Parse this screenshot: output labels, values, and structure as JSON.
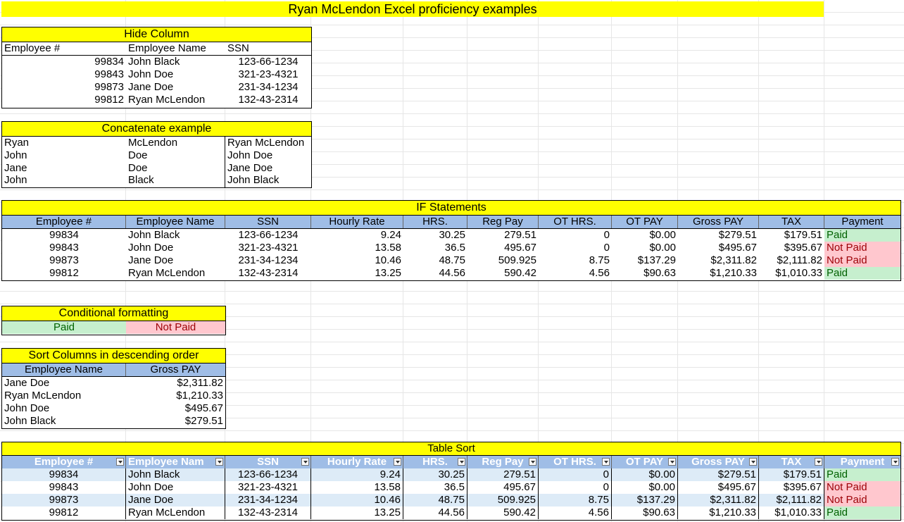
{
  "title": "Ryan McLendon Excel proficiency examples",
  "hide_column": {
    "title": "Hide Column",
    "headers": [
      "Employee #",
      "Employee Name",
      "SSN"
    ],
    "rows": [
      [
        "99834",
        "John Black",
        "123-66-1234"
      ],
      [
        "99843",
        "John Doe",
        "321-23-4321"
      ],
      [
        "99873",
        "Jane Doe",
        "231-34-1234"
      ],
      [
        "99812",
        "Ryan McLendon",
        "132-43-2314"
      ]
    ]
  },
  "concatenate": {
    "title": "Concatenate example",
    "rows": [
      [
        "Ryan",
        "McLendon",
        "Ryan McLendon"
      ],
      [
        "John",
        "Doe",
        "John Doe"
      ],
      [
        "Jane",
        "Doe",
        "Jane Doe"
      ],
      [
        "John",
        "Black",
        "John Black"
      ]
    ]
  },
  "if_statements": {
    "title": "IF Statements",
    "headers": [
      "Employee #",
      "Employee Name",
      "SSN",
      "Hourly Rate",
      "HRS.",
      "Reg Pay",
      "OT HRS.",
      "OT PAY",
      "Gross PAY",
      "TAX",
      "Payment"
    ],
    "rows": [
      [
        "99834",
        "John Black",
        "123-66-1234",
        "9.24",
        "30.25",
        "279.51",
        "0",
        "$0.00",
        "$279.51",
        "$179.51",
        "Paid"
      ],
      [
        "99843",
        "John Doe",
        "321-23-4321",
        "13.58",
        "36.5",
        "495.67",
        "0",
        "$0.00",
        "$495.67",
        "$395.67",
        "Not Paid"
      ],
      [
        "99873",
        "Jane Doe",
        "231-34-1234",
        "10.46",
        "48.75",
        "509.925",
        "8.75",
        "$137.29",
        "$2,311.82",
        "$2,111.82",
        "Not Paid"
      ],
      [
        "99812",
        "Ryan McLendon",
        "132-43-2314",
        "13.25",
        "44.56",
        "590.42",
        "4.56",
        "$90.63",
        "$1,210.33",
        "$1,010.33",
        "Paid"
      ]
    ]
  },
  "conditional": {
    "title": "Conditional formatting",
    "paid": "Paid",
    "not_paid": "Not Paid",
    "colors": {
      "paid_bg": "#c6efce",
      "paid_fg": "#006100",
      "notpaid_bg": "#ffc7ce",
      "notpaid_fg": "#9c0006"
    }
  },
  "sort_columns": {
    "title": "Sort Columns in descending order",
    "headers": [
      "Employee Name",
      "Gross PAY"
    ],
    "rows": [
      [
        "Jane Doe",
        "$2,311.82"
      ],
      [
        "Ryan McLendon",
        "$1,210.33"
      ],
      [
        "John Doe",
        "$495.67"
      ],
      [
        "John Black",
        "$279.51"
      ]
    ]
  },
  "table_sort": {
    "title": "Table Sort",
    "headers": [
      "Employee #",
      "Employee Nam",
      "SSN",
      "Hourly Rate",
      "HRS.",
      "Reg Pay",
      "OT HRS.",
      "OT PAY",
      "Gross PAY",
      "TAX",
      "Payment"
    ],
    "rows": [
      [
        "99834",
        "John Black",
        "123-66-1234",
        "9.24",
        "30.25",
        "279.51",
        "0",
        "$0.00",
        "$279.51",
        "$179.51",
        "Paid"
      ],
      [
        "99843",
        "John Doe",
        "321-23-4321",
        "13.58",
        "36.5",
        "495.67",
        "0",
        "$0.00",
        "$495.67",
        "$395.67",
        "Not Paid"
      ],
      [
        "99873",
        "Jane Doe",
        "231-34-1234",
        "10.46",
        "48.75",
        "509.925",
        "8.75",
        "$137.29",
        "$2,311.82",
        "$2,111.82",
        "Not Paid"
      ],
      [
        "99812",
        "Ryan McLendon",
        "132-43-2314",
        "13.25",
        "44.56",
        "590.42",
        "4.56",
        "$90.63",
        "$1,210.33",
        "$1,010.33",
        "Paid"
      ]
    ]
  },
  "colors": {
    "title_bg": "#ffff00",
    "header_blue": "#9fbde6",
    "stripe": "#ddebf7"
  }
}
